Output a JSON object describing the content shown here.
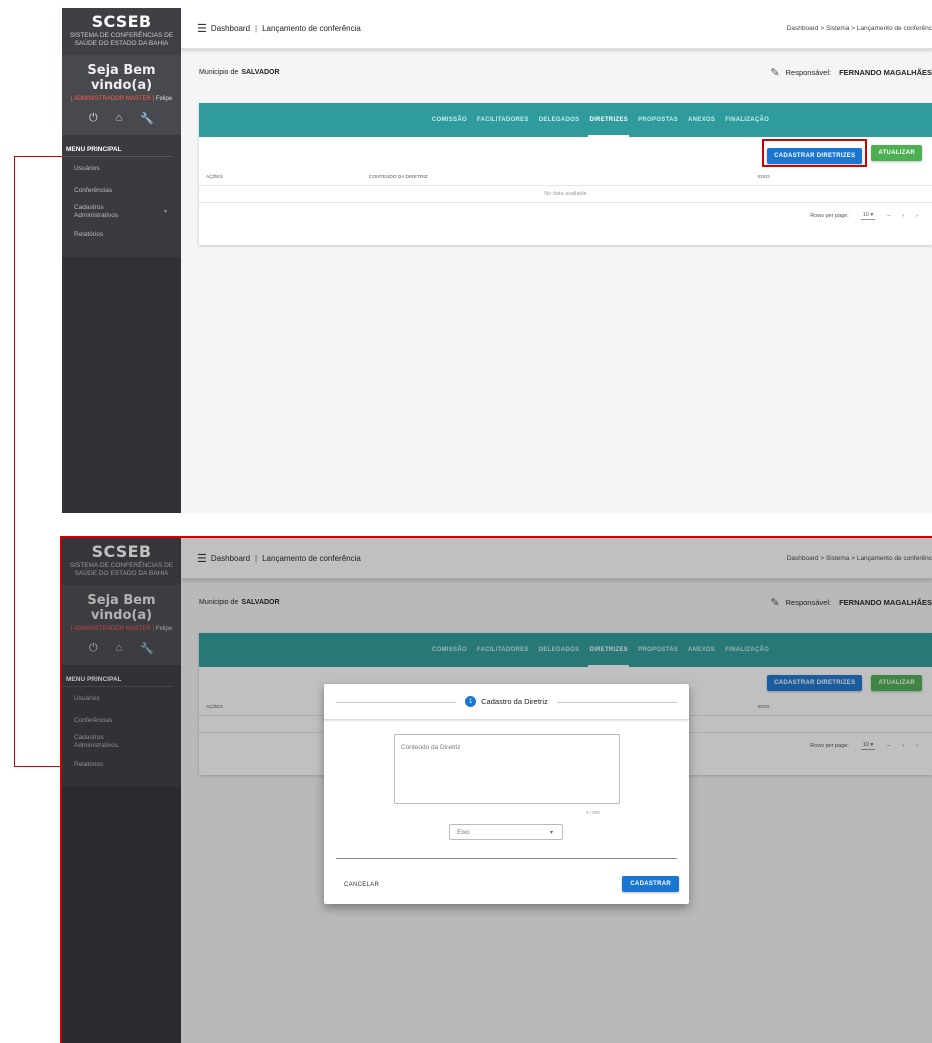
{
  "brand": {
    "title": "SCSEB",
    "subtitle_line1": "SISTEMA DE CONFERÊNCIAS DE",
    "subtitle_line2": "SAÚDE DO ESTADO DA BAHIA"
  },
  "welcome": {
    "title": "Seja Bem vindo(a)",
    "role": "[ ADMINISTRADOR MASTER ]",
    "user": "Felipe"
  },
  "menu": {
    "title": "MENU PRINCIPAL",
    "items": [
      {
        "label": "Usuários"
      },
      {
        "label": "Conferências"
      },
      {
        "label_line1": "Cadastros",
        "label_line2": "Administrativos"
      },
      {
        "label": "Relatórios"
      }
    ]
  },
  "topbar": {
    "dashboard": "Dashboard",
    "separator": "|",
    "page": "Lançamento de conferência",
    "breadcrumb": "Dashboard  >  Sistema  >  Lançamento de conferênc"
  },
  "municipio": {
    "label": "Municipio de",
    "name": "SALVADOR"
  },
  "responsavel": {
    "label": "Responsável:",
    "name": "FERNANDO MAGALHÃES"
  },
  "tabs": [
    "COMISSÃO",
    "FACILITADORES",
    "DELEGADOS",
    "DIRETRIZES",
    "PROPOSTAS",
    "ANEXOS",
    "FINALIZAÇÃO"
  ],
  "active_tab": "DIRETRIZES",
  "buttons": {
    "cadastrar": "CADASTRAR DIRETRIZES",
    "atualizar": "ATUALIZAR"
  },
  "table": {
    "headers": [
      "AÇÕES",
      "CONTEÚDO DA DIRETRIZ",
      "EIXO"
    ],
    "no_data": "No data available"
  },
  "pager": {
    "rows_per_page": "Rows per page:",
    "value": "10",
    "range": "–",
    "prev": "‹",
    "next": "›"
  },
  "dialog": {
    "step": "1",
    "title": "Cadastro da Diretriz",
    "content_placeholder": "Conteúdo da Diretriz",
    "counter": "0 / 600",
    "eixo_placeholder": "Eixo",
    "cancel": "CANCELAR",
    "submit": "CADASTRAR"
  },
  "colors": {
    "sidebar": "#303036",
    "teal": "#2f9b9c",
    "primary": "#1976d2",
    "success": "#4caf50",
    "highlight": "#d40000"
  }
}
